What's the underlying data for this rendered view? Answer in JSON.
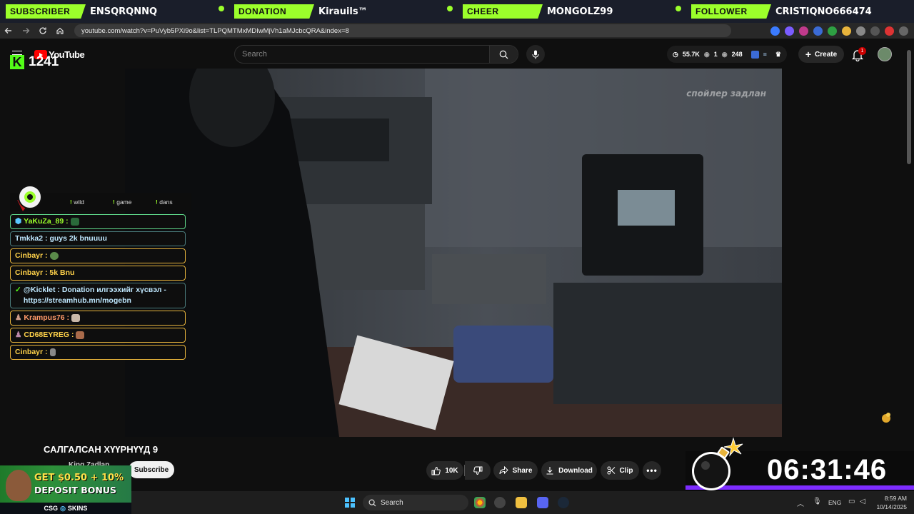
{
  "alerts": [
    {
      "tag": "SUBSCRIBER",
      "name": "ENSQRQNNQ"
    },
    {
      "tag": "DONATION",
      "name": "Kirauils™"
    },
    {
      "tag": "CHEER",
      "name": "MONGOLZ99"
    },
    {
      "tag": "FOLLOWER",
      "name": "CRISTIQNO666474"
    }
  ],
  "browser": {
    "url": "youtube.com/watch?v=PuVyb5PXi9o&list=TLPQMTMxMDIwMjVh1aMJcbcQRA&index=8",
    "back_icon": "arrow-left-icon",
    "forward_icon": "arrow-right-icon",
    "reload_icon": "reload-icon",
    "home_icon": "home-icon"
  },
  "youtube": {
    "logo_text": "YouTube",
    "search_placeholder": "Search",
    "stats": {
      "views": "55.7K",
      "eye": "1",
      "viewers": "248"
    },
    "create_label": "Create",
    "notification_count": "1"
  },
  "kick": {
    "viewer_count": "1241"
  },
  "video": {
    "overlay_text": "спойлер задлан"
  },
  "chat": {
    "commands": [
      "wild",
      "game",
      "dans"
    ],
    "messages": [
      {
        "user": "YaKuZa_89 :",
        "text": "",
        "style": "green"
      },
      {
        "user": "",
        "text": "Tmkka2 : guys 2k bnuuuu",
        "style": "green2"
      },
      {
        "user": "Cinbayr :",
        "text": "",
        "style": "gold"
      },
      {
        "user": "Cinbayr : 5k Bnu",
        "text": "",
        "style": "gold"
      },
      {
        "user": "@Kicklet : Donation илгээхийг хүсвэл - https://streamhub.mn/mogebn",
        "text": "",
        "style": "green2"
      },
      {
        "user": "Krampus76 :",
        "text": "",
        "style": "gold"
      },
      {
        "user": "CD68EYREG :",
        "text": "",
        "style": "gold"
      },
      {
        "user": "Cinbayr :",
        "text": "",
        "style": "gold"
      }
    ]
  },
  "info": {
    "title": "САЛГАЛСАН ХҮҮРНҮҮД 9",
    "channel": "King Zadlan",
    "subscribe_label": "Subscribe",
    "likes": "10K",
    "share_label": "Share",
    "download_label": "Download",
    "clip_label": "Clip"
  },
  "promo": {
    "line1": "GET $0.50 + 10%",
    "line2": "DEPOSIT BONUS",
    "brand": "CSG",
    "brand2": "SKINS"
  },
  "timer": {
    "value": "06:31:46"
  },
  "taskbar": {
    "search_label": "Search",
    "lang": "ENG",
    "time": "8:59 AM",
    "date": "10/14/2025"
  },
  "colors": {
    "alert_accent": "#9bff2b",
    "kick_green": "#53fc18",
    "youtube_red": "#ff0000",
    "timer_bar": "#7d2cff"
  }
}
